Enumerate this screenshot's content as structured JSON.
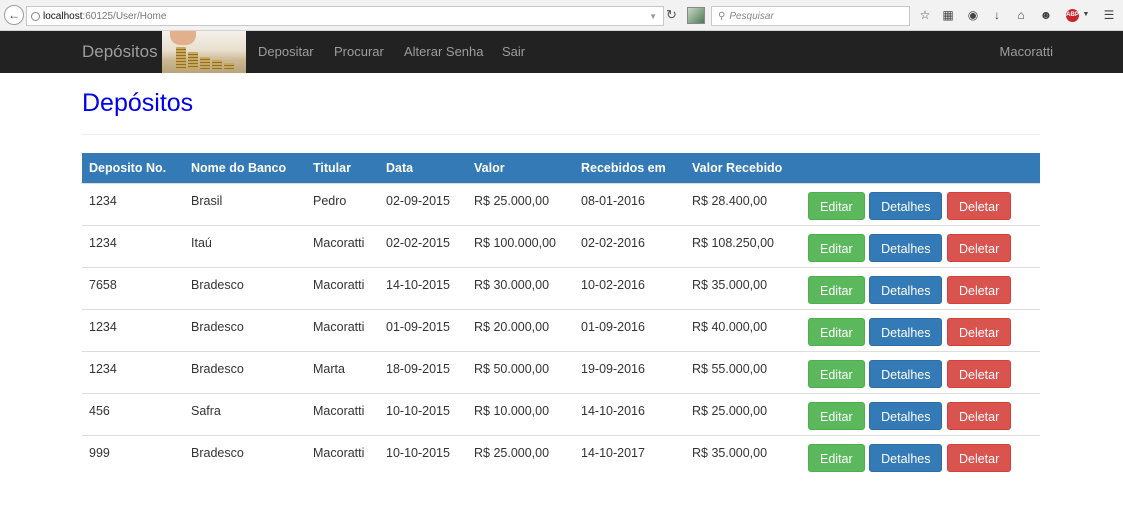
{
  "browser": {
    "url_host": "localhost",
    "url_path": ":60125/User/Home",
    "search_placeholder": "Pesquisar"
  },
  "navbar": {
    "brand": "Depósitos",
    "links": [
      "Depositar",
      "Procurar",
      "Alterar Senha",
      "Sair"
    ],
    "user": "Macoratti"
  },
  "page": {
    "title": "Depósitos"
  },
  "table": {
    "headers": [
      "Deposito No.",
      "Nome do Banco",
      "Titular",
      "Data",
      "Valor",
      "Recebidos em",
      "Valor Recebido"
    ],
    "action_labels": {
      "edit": "Editar",
      "details": "Detalhes",
      "delete": "Deletar"
    },
    "rows": [
      [
        "1234",
        "Brasil",
        "Pedro",
        "02-09-2015",
        "R$ 25.000,00",
        "08-01-2016",
        "R$ 28.400,00"
      ],
      [
        "1234",
        "Itaú",
        "Macoratti",
        "02-02-2015",
        "R$ 100.000,00",
        "02-02-2016",
        "R$ 108.250,00"
      ],
      [
        "7658",
        "Bradesco",
        "Macoratti",
        "14-10-2015",
        "R$ 30.000,00",
        "10-02-2016",
        "R$ 35.000,00"
      ],
      [
        "1234",
        "Bradesco",
        "Macoratti",
        "01-09-2015",
        "R$ 20.000,00",
        "01-09-2016",
        "R$ 40.000,00"
      ],
      [
        "1234",
        "Bradesco",
        "Marta",
        "18-09-2015",
        "R$ 50.000,00",
        "19-09-2016",
        "R$ 55.000,00"
      ],
      [
        "456",
        "Safra",
        "Macoratti",
        "10-10-2015",
        "R$ 10.000,00",
        "14-10-2016",
        "R$ 25.000,00"
      ],
      [
        "999",
        "Bradesco",
        "Macoratti",
        "10-10-2015",
        "R$ 25.000,00",
        "14-10-2017",
        "R$ 35.000,00"
      ]
    ]
  },
  "colors": {
    "navbar_bg": "#222222",
    "header_bg": "#337ab7",
    "title": "#0000ee",
    "edit": "#5cb85c",
    "details": "#337ab7",
    "delete": "#d9534f"
  }
}
